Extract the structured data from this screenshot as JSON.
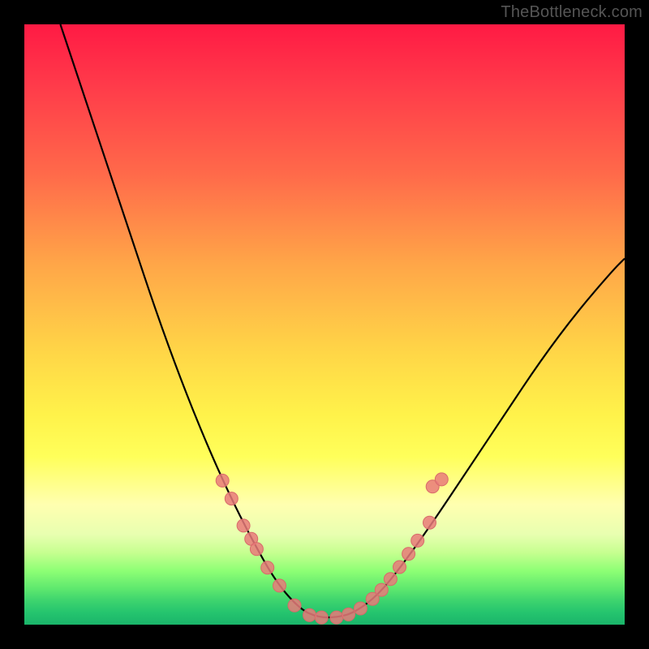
{
  "watermark": "TheBottleneck.com",
  "colors": {
    "curve": "#000000",
    "marker_fill": "#e97a7a",
    "marker_stroke": "#d86a6a",
    "background_black": "#000000"
  },
  "chart_data": {
    "type": "line",
    "title": "",
    "xlabel": "",
    "ylabel": "",
    "xlim": [
      0,
      100
    ],
    "ylim": [
      0,
      100
    ],
    "note": "Axes unlabeled; values are percent of plot area (x: left→right, y: bottom→top). Curve falls from top-left to a flat minimum near center, then rises to right.",
    "curve_points": [
      {
        "x": 6,
        "y": 100
      },
      {
        "x": 10,
        "y": 88
      },
      {
        "x": 14,
        "y": 76
      },
      {
        "x": 18,
        "y": 64
      },
      {
        "x": 22,
        "y": 52
      },
      {
        "x": 26,
        "y": 41
      },
      {
        "x": 30,
        "y": 31
      },
      {
        "x": 34,
        "y": 22
      },
      {
        "x": 38,
        "y": 14
      },
      {
        "x": 42,
        "y": 7
      },
      {
        "x": 46,
        "y": 2.5
      },
      {
        "x": 49,
        "y": 1.2
      },
      {
        "x": 52,
        "y": 1.2
      },
      {
        "x": 55,
        "y": 2.0
      },
      {
        "x": 59,
        "y": 5
      },
      {
        "x": 63,
        "y": 10
      },
      {
        "x": 68,
        "y": 17
      },
      {
        "x": 74,
        "y": 26
      },
      {
        "x": 80,
        "y": 35
      },
      {
        "x": 86,
        "y": 44
      },
      {
        "x": 92,
        "y": 52
      },
      {
        "x": 98,
        "y": 59
      },
      {
        "x": 100,
        "y": 61
      }
    ],
    "markers": [
      {
        "x": 33.0,
        "y": 24.0
      },
      {
        "x": 34.5,
        "y": 21.0
      },
      {
        "x": 36.5,
        "y": 16.5
      },
      {
        "x": 37.8,
        "y": 14.3
      },
      {
        "x": 38.7,
        "y": 12.6
      },
      {
        "x": 40.5,
        "y": 9.5
      },
      {
        "x": 42.5,
        "y": 6.5
      },
      {
        "x": 45.0,
        "y": 3.2
      },
      {
        "x": 47.5,
        "y": 1.6
      },
      {
        "x": 49.5,
        "y": 1.2
      },
      {
        "x": 52.0,
        "y": 1.2
      },
      {
        "x": 54.0,
        "y": 1.7
      },
      {
        "x": 56.0,
        "y": 2.7
      },
      {
        "x": 58.0,
        "y": 4.3
      },
      {
        "x": 59.5,
        "y": 5.8
      },
      {
        "x": 61.0,
        "y": 7.6
      },
      {
        "x": 62.5,
        "y": 9.6
      },
      {
        "x": 64.0,
        "y": 11.8
      },
      {
        "x": 65.5,
        "y": 14.0
      },
      {
        "x": 67.5,
        "y": 17.0
      },
      {
        "x": 68.0,
        "y": 23.0
      },
      {
        "x": 69.5,
        "y": 24.2
      }
    ]
  }
}
